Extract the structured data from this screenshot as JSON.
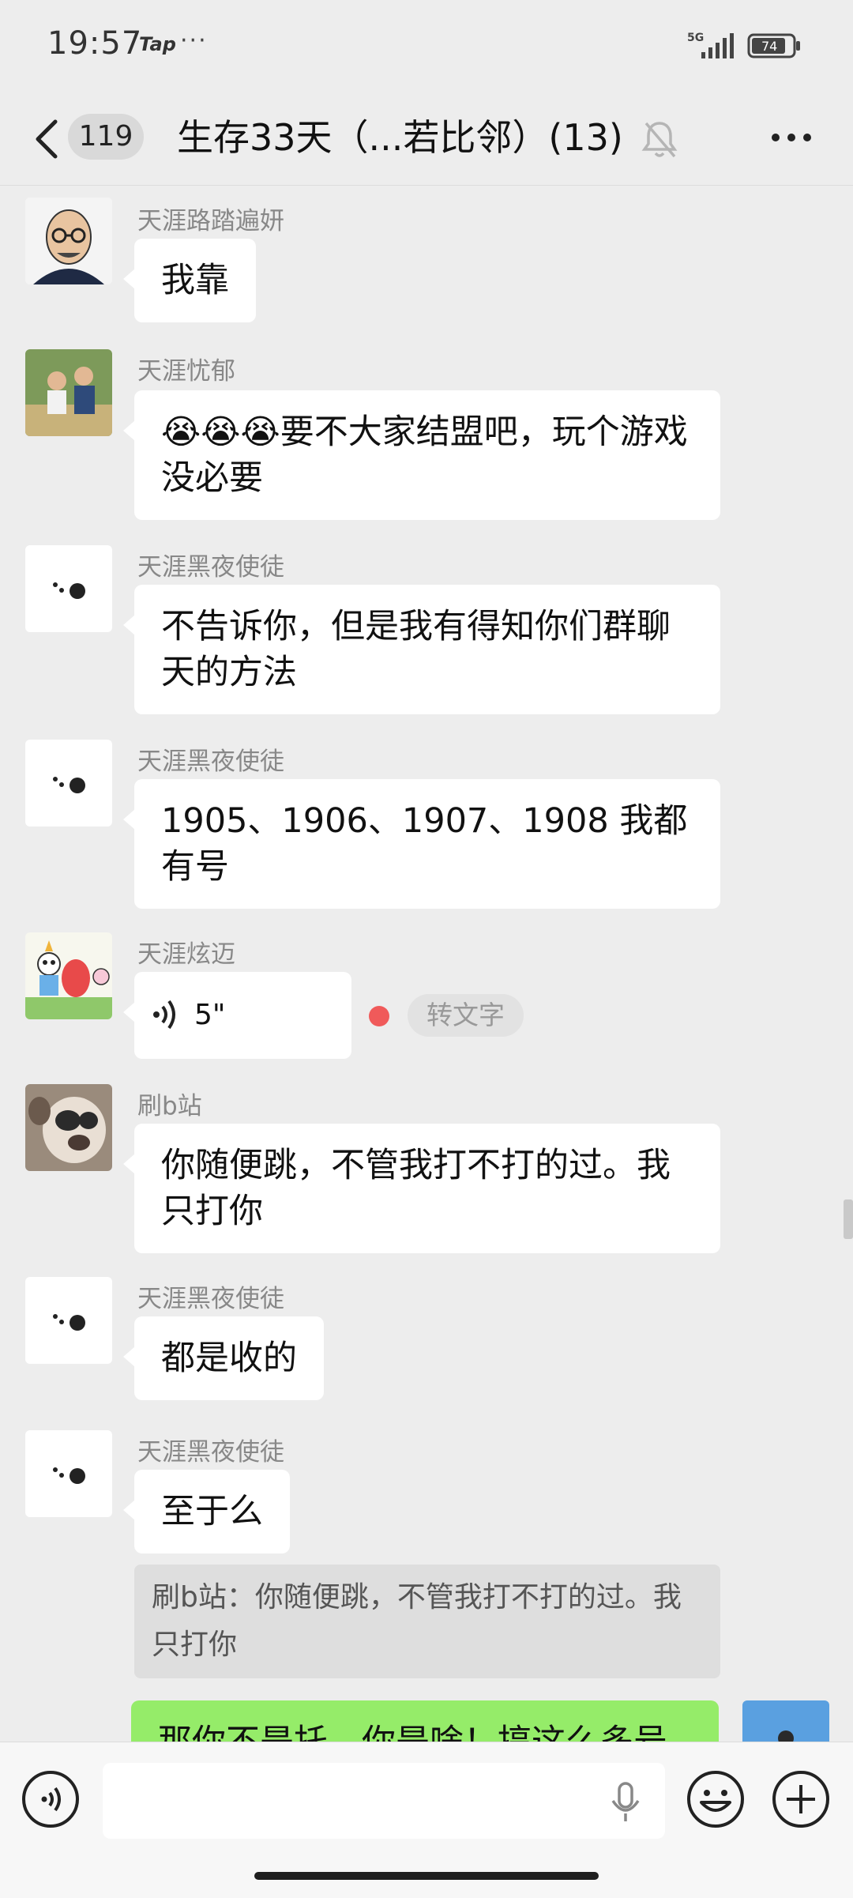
{
  "status_bar": {
    "time": "19:57",
    "tap_label": "Tap",
    "overflow": "···",
    "network": "5G",
    "battery": "74"
  },
  "header": {
    "back_count": "119",
    "title": "生存33天（...若比邻）(13)"
  },
  "messages": [
    {
      "sender": "天涯路踏遍妍",
      "text": "我靠",
      "avatar": "bald-man-glasses-avatar"
    },
    {
      "sender": "天涯忧郁",
      "text": "😭😭😭要不大家结盟吧，玩个游戏没必要",
      "avatar": "kids-photo-avatar"
    },
    {
      "sender": "天涯黑夜使徒",
      "text": "不告诉你，但是我有得知你们群聊天的方法",
      "avatar": "dots-avatar"
    },
    {
      "sender": "天涯黑夜使徒",
      "text": "1905、1906、1907、1908 我都有号",
      "avatar": "dots-avatar"
    },
    {
      "sender": "天涯炫迈",
      "voice_duration": "5\"",
      "to_text": "转文字",
      "avatar": "cartoon-strawberry-avatar"
    },
    {
      "sender": "刷b站",
      "text": "你随便跳，不管我打不打的过。我只打你",
      "avatar": "dog-photo-avatar"
    },
    {
      "sender": "天涯黑夜使徒",
      "text": "都是收的",
      "avatar": "dots-avatar"
    },
    {
      "sender": "天涯黑夜使徒",
      "text": "至于么",
      "avatar": "dots-avatar"
    }
  ],
  "quote": {
    "text": "刷b站：你随便跳，不管我打不打的过。我只打你"
  },
  "my_message": {
    "text": "那你不是托，你是啥！搞这么多号"
  },
  "colors": {
    "background": "#ededed",
    "bubble": "#ffffff",
    "my_bubble": "#95ec69",
    "unread_dot": "#f05a5a"
  }
}
